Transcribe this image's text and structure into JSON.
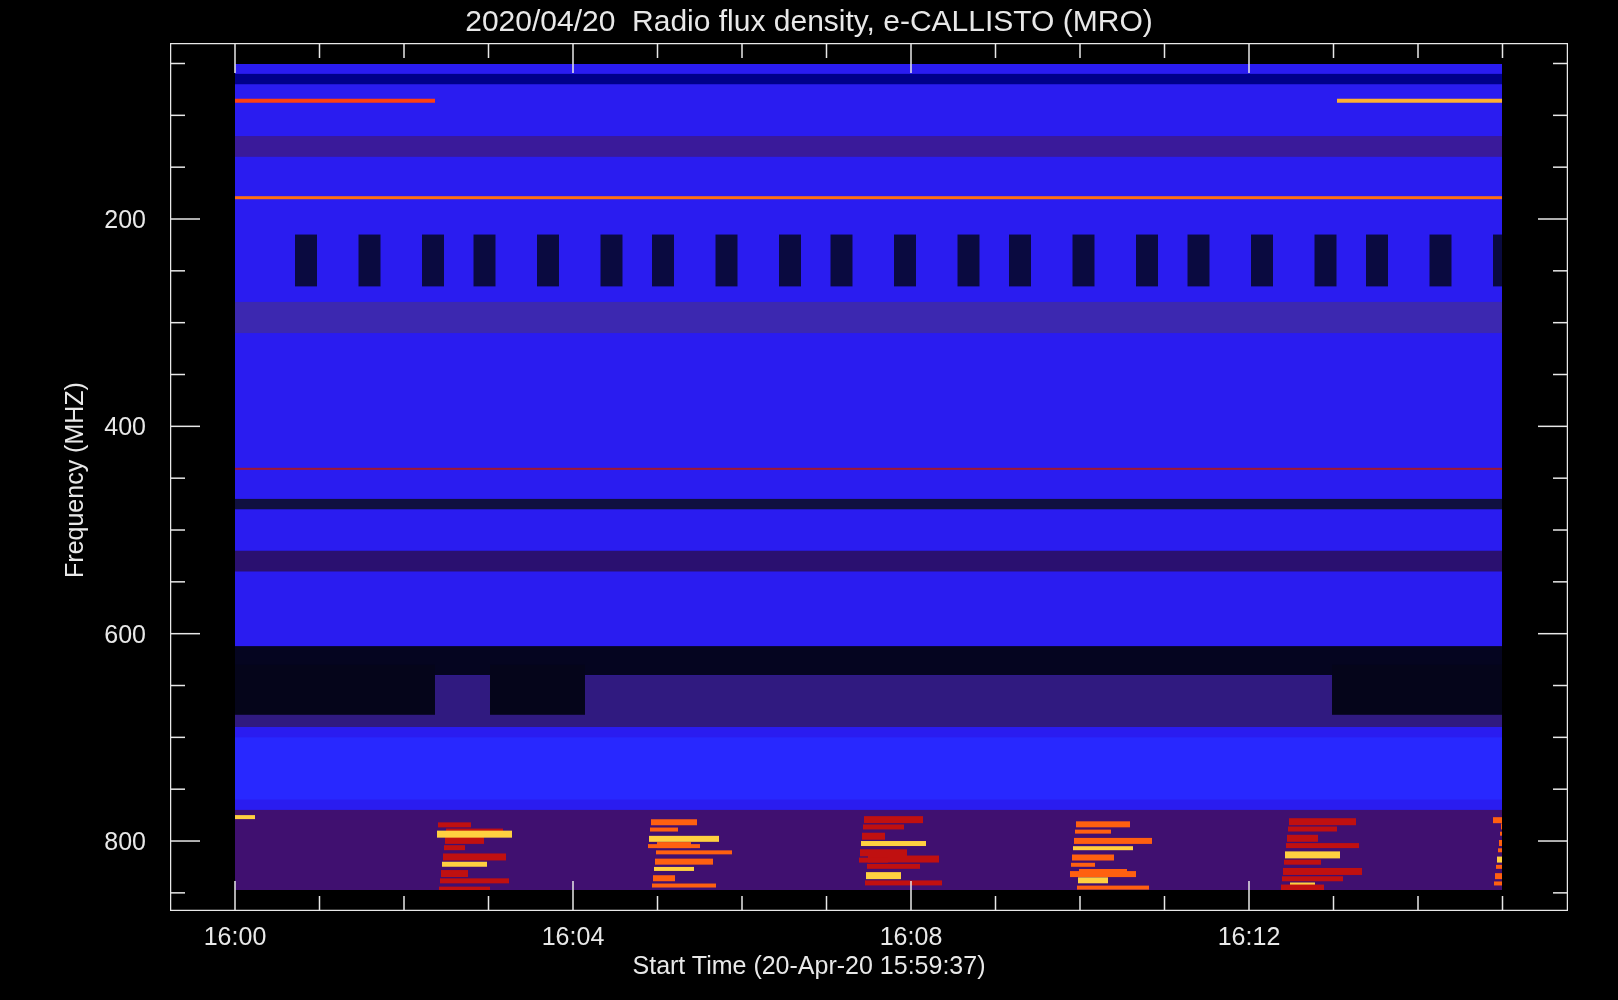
{
  "title": "2020/04/20  Radio flux density, e-CALLISTO (MRO)",
  "y_axis": {
    "label": "Frequency (MHZ)",
    "ticks": [
      "200",
      "400",
      "600",
      "800"
    ]
  },
  "x_axis": {
    "label": "Start Time (20-Apr-20 15:59:37)",
    "ticks": [
      "16:00",
      "16:04",
      "16:08",
      "16:12"
    ]
  }
}
